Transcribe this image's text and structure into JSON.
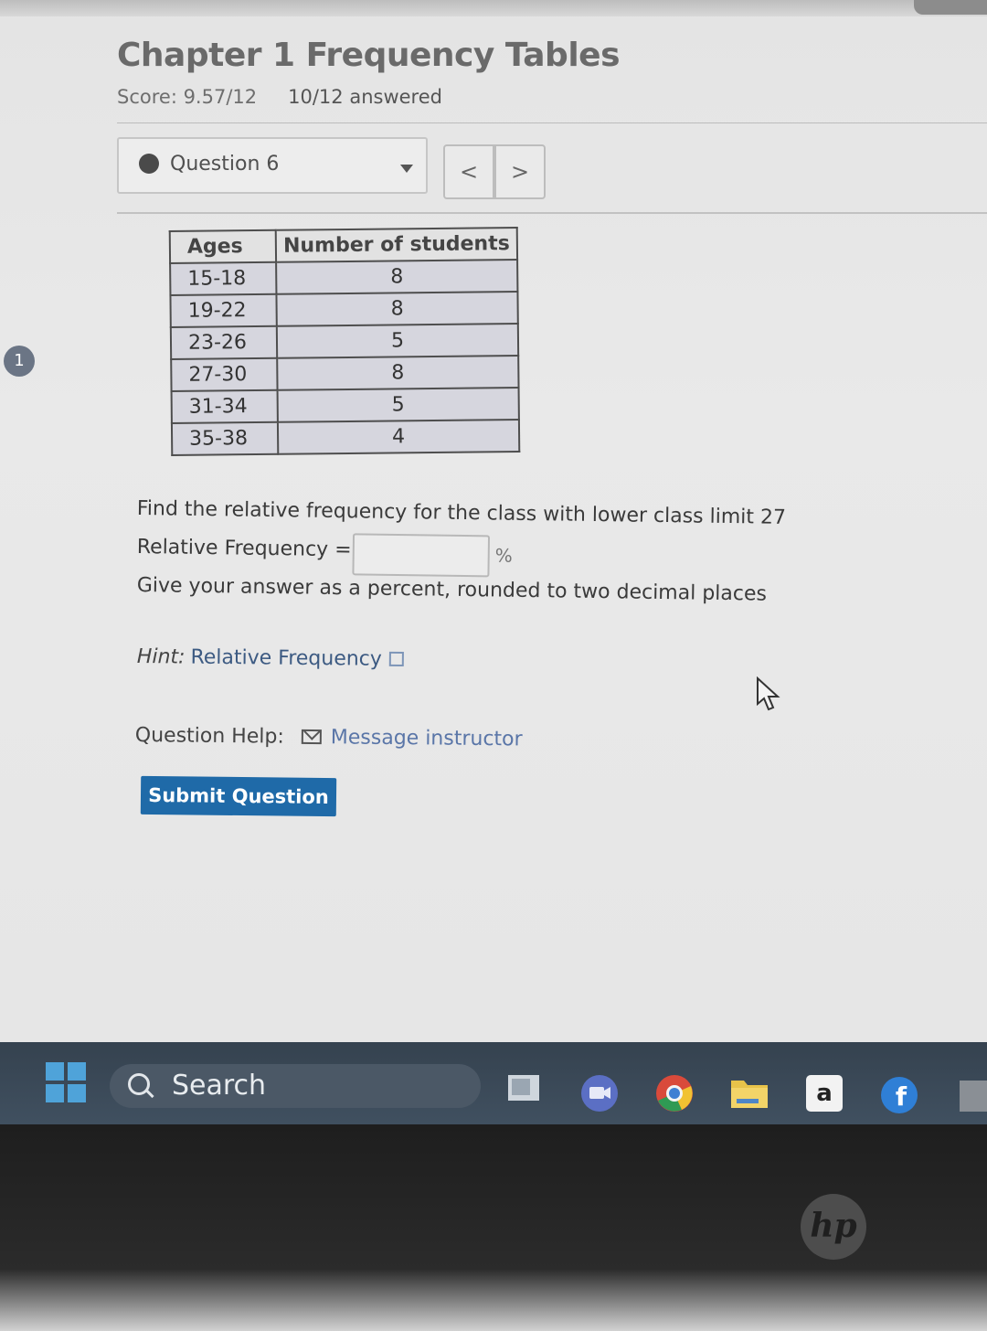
{
  "header": {
    "title": "Chapter 1 Frequency Tables",
    "score": "Score: 9.57/12",
    "answered": "10/12 answered"
  },
  "question_selector": {
    "label": "Question 6"
  },
  "nav": {
    "prev": "<",
    "next": ">"
  },
  "side_badge": "1",
  "table": {
    "headers": [
      "Ages",
      "Number of students"
    ],
    "rows": [
      [
        "15-18",
        "8"
      ],
      [
        "19-22",
        "8"
      ],
      [
        "23-26",
        "5"
      ],
      [
        "27-30",
        "8"
      ],
      [
        "31-34",
        "5"
      ],
      [
        "35-38",
        "4"
      ]
    ]
  },
  "question": {
    "prompt": "Find the relative frequency for the class with lower class limit 27",
    "rf_label": "Relative Frequency =",
    "rf_value": "",
    "rf_unit": "%",
    "instructions": "Give your answer as a percent, rounded to two decimal places"
  },
  "hint": {
    "label": "Hint:",
    "link": "Relative Frequency"
  },
  "help": {
    "label": "Question Help:",
    "link": "Message instructor"
  },
  "submit_label": "Submit Question",
  "taskbar": {
    "search_label": "Search",
    "icons": [
      "windows-start-icon",
      "search-icon",
      "file-explorer-icon",
      "video-chat-icon",
      "chrome-icon",
      "folder-icon",
      "amazon-icon",
      "facebook-icon"
    ]
  },
  "hp_logo": "hp"
}
